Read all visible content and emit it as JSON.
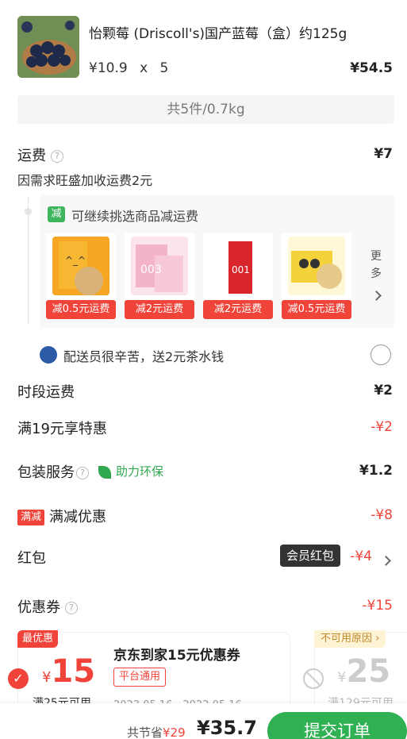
{
  "product": {
    "name": "怡颗莓 (Driscoll's)国产蓝莓（盒）约125g",
    "unit_price": "¥10.9",
    "times": "x",
    "qty": "5",
    "total": "¥54.5"
  },
  "summary": "共5件/0.7kg",
  "shipping": {
    "label": "运费",
    "value": "¥7",
    "note": "因需求旺盛加收运费2元",
    "promo_tag": "减",
    "promo_title": "可继续挑选商品减运费",
    "goods": [
      {
        "tag": "减0.5元运费",
        "color": "#f5a623"
      },
      {
        "tag": "减2元运费",
        "color": "#f3b3c8"
      },
      {
        "tag": "减2元运费",
        "color": "#d8242b"
      },
      {
        "tag": "减0.5元运费",
        "color": "#f4d23b"
      }
    ],
    "more": [
      "更",
      "多"
    ],
    "tip_text": "配送员很辛苦，送2元茶水钱"
  },
  "rows": {
    "period_fee": {
      "label": "时段运费",
      "value": "¥2"
    },
    "over19": {
      "label": "满19元享特惠",
      "value": "-¥2"
    },
    "packing": {
      "label": "包装服务",
      "eco": "助力环保",
      "value": "¥1.2"
    },
    "full_reduce": {
      "badge": "满减",
      "label": "满减优惠",
      "value": "-¥8"
    },
    "red_packet": {
      "label": "红包",
      "badge": "会员红包",
      "value": "-¥4"
    },
    "coupon": {
      "label": "优惠券",
      "value": "-¥15"
    }
  },
  "coupons": {
    "best_tag": "最优惠",
    "a_currency": "¥",
    "a_amount": "15",
    "a_cond": "满25元可用",
    "a_title": "京东到家15元优惠券",
    "a_scope": "平台通用",
    "a_date": "2022.05.16 - 2022.05.16",
    "unusable_tag": "不可用原因",
    "b_currency": "¥",
    "b_amount": "25",
    "b_cond": "满129元可用"
  },
  "bottom": {
    "saved_prefix": "共节省",
    "saved": "¥29",
    "total": "¥35.7",
    "submit": "提交订单"
  }
}
